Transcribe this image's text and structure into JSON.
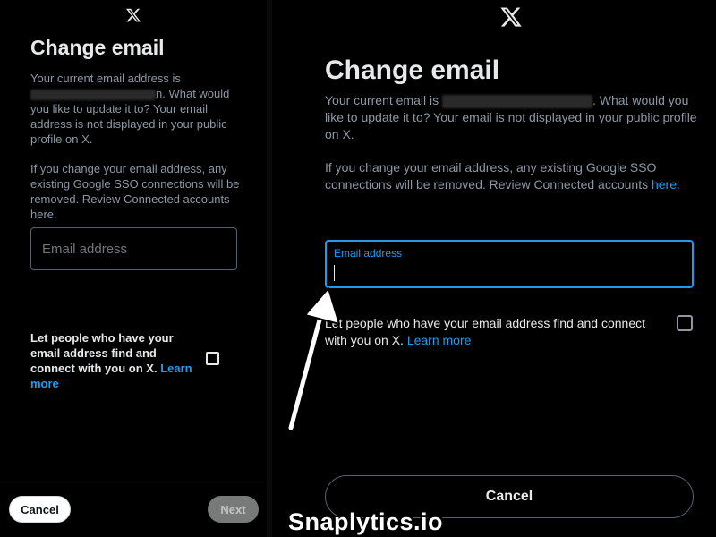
{
  "left": {
    "logo_icon": "x-logo-icon",
    "title": "Change email",
    "para1_before": "Your current email address is",
    "para1_redacted_tail": "n.",
    "para1_after": "What would you like to update it to? Your email address is not displayed in your public profile on X.",
    "para2": "If you change your email address, any existing Google SSO connections will be removed. Review Connected accounts here.",
    "email_placeholder": "Email address",
    "share_text": "Let people who have your email address find and connect with you on X.",
    "share_link": "Learn more",
    "cancel_label": "Cancel",
    "next_label": "Next"
  },
  "right": {
    "logo_icon": "x-logo-icon",
    "title": "Change email",
    "para1_before": "Your current email is",
    "para1_after": ". What would you like to update it to? Your email is not displayed in your public profile on X.",
    "para2_text": "If you change your email address, any existing Google SSO connections will be removed. Review Connected accounts",
    "para2_link": "here.",
    "email_label": "Email address",
    "email_value": "",
    "share_text": "Let people who have your email address find and connect with you on X.",
    "share_link": "Learn more",
    "cancel_label": "Cancel"
  },
  "overlay": {
    "arrow_icon": "white-arrow-icon",
    "watermark": "Snaplytics.io"
  },
  "colors": {
    "background": "#000000",
    "accent": "#1d9bf0",
    "text_primary": "#e7e9ea",
    "text_secondary": "#8b98a5",
    "next_disabled": "#787a7a"
  }
}
